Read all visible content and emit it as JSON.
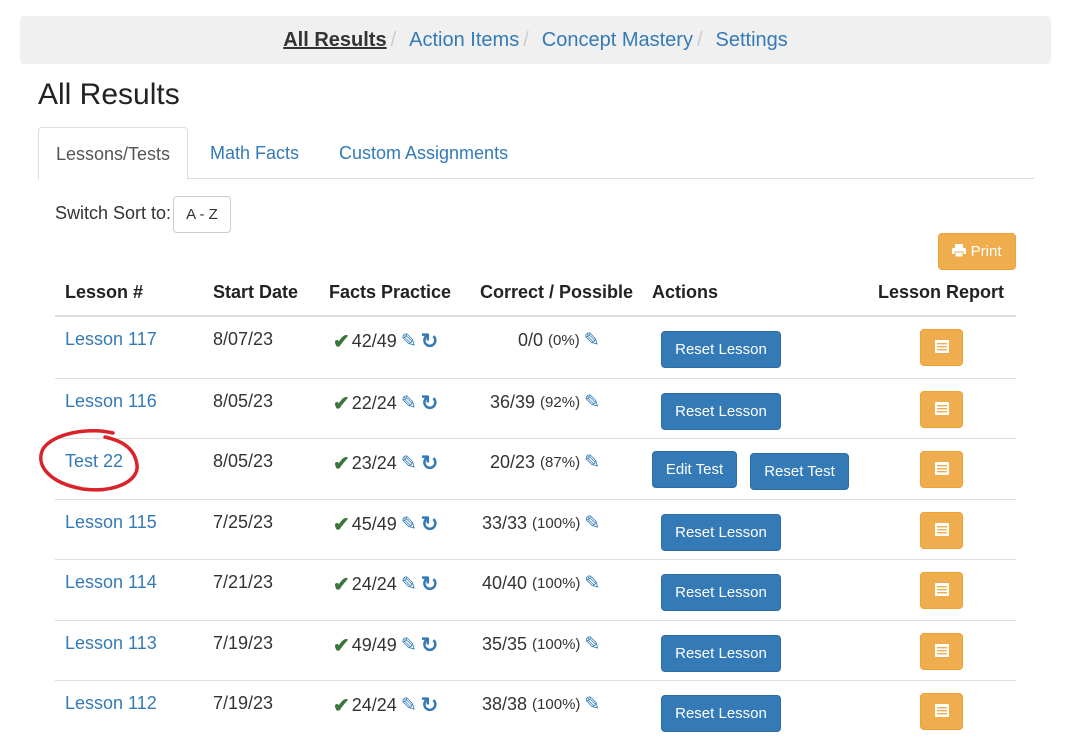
{
  "breadcrumb": [
    {
      "label": "All Results",
      "active": true
    },
    {
      "label": "Action Items",
      "active": false
    },
    {
      "label": "Concept Mastery",
      "active": false
    },
    {
      "label": "Settings",
      "active": false
    }
  ],
  "breadcrumb_separator": "/",
  "page_title": "All Results",
  "tabs": [
    {
      "label": "Lessons/Tests",
      "active": true
    },
    {
      "label": "Math Facts",
      "active": false
    },
    {
      "label": "Custom Assignments",
      "active": false
    }
  ],
  "sort": {
    "label": "Switch Sort to:",
    "button": "A - Z"
  },
  "print_label": "Print",
  "columns": [
    "Lesson #",
    "Start Date",
    "Facts Practice",
    "Correct / Possible",
    "Actions",
    "Lesson Report"
  ],
  "rows": [
    {
      "name": "Lesson 117",
      "date": "8/07/23",
      "facts": "42/49",
      "score": "0/0",
      "pct": "(0%)",
      "actions": [
        "Reset Lesson"
      ]
    },
    {
      "name": "Lesson 116",
      "date": "8/05/23",
      "facts": "22/24",
      "score": "36/39",
      "pct": "(92%)",
      "actions": [
        "Reset Lesson"
      ]
    },
    {
      "name": "Test 22",
      "date": "8/05/23",
      "facts": "23/24",
      "score": "20/23",
      "pct": "(87%)",
      "actions": [
        "Edit Test",
        "Reset Test"
      ]
    },
    {
      "name": "Lesson 115",
      "date": "7/25/23",
      "facts": "45/49",
      "score": "33/33",
      "pct": "(100%)",
      "actions": [
        "Reset Lesson"
      ]
    },
    {
      "name": "Lesson 114",
      "date": "7/21/23",
      "facts": "24/24",
      "score": "40/40",
      "pct": "(100%)",
      "actions": [
        "Reset Lesson"
      ]
    },
    {
      "name": "Lesson 113",
      "date": "7/19/23",
      "facts": "49/49",
      "score": "35/35",
      "pct": "(100%)",
      "actions": [
        "Reset Lesson"
      ]
    },
    {
      "name": "Lesson 112",
      "date": "7/19/23",
      "facts": "24/24",
      "score": "38/38",
      "pct": "(100%)",
      "actions": [
        "Reset Lesson"
      ]
    }
  ],
  "icons": {
    "check": "check-icon",
    "edit": "pencil-icon",
    "retry": "refresh-icon",
    "report": "list-icon",
    "print": "printer-icon"
  },
  "colors": {
    "link": "#337ab7",
    "primary_button": "#337ab7",
    "warning_button": "#f0ad4e",
    "check": "#3c763d",
    "annotation": "#d9232a"
  }
}
